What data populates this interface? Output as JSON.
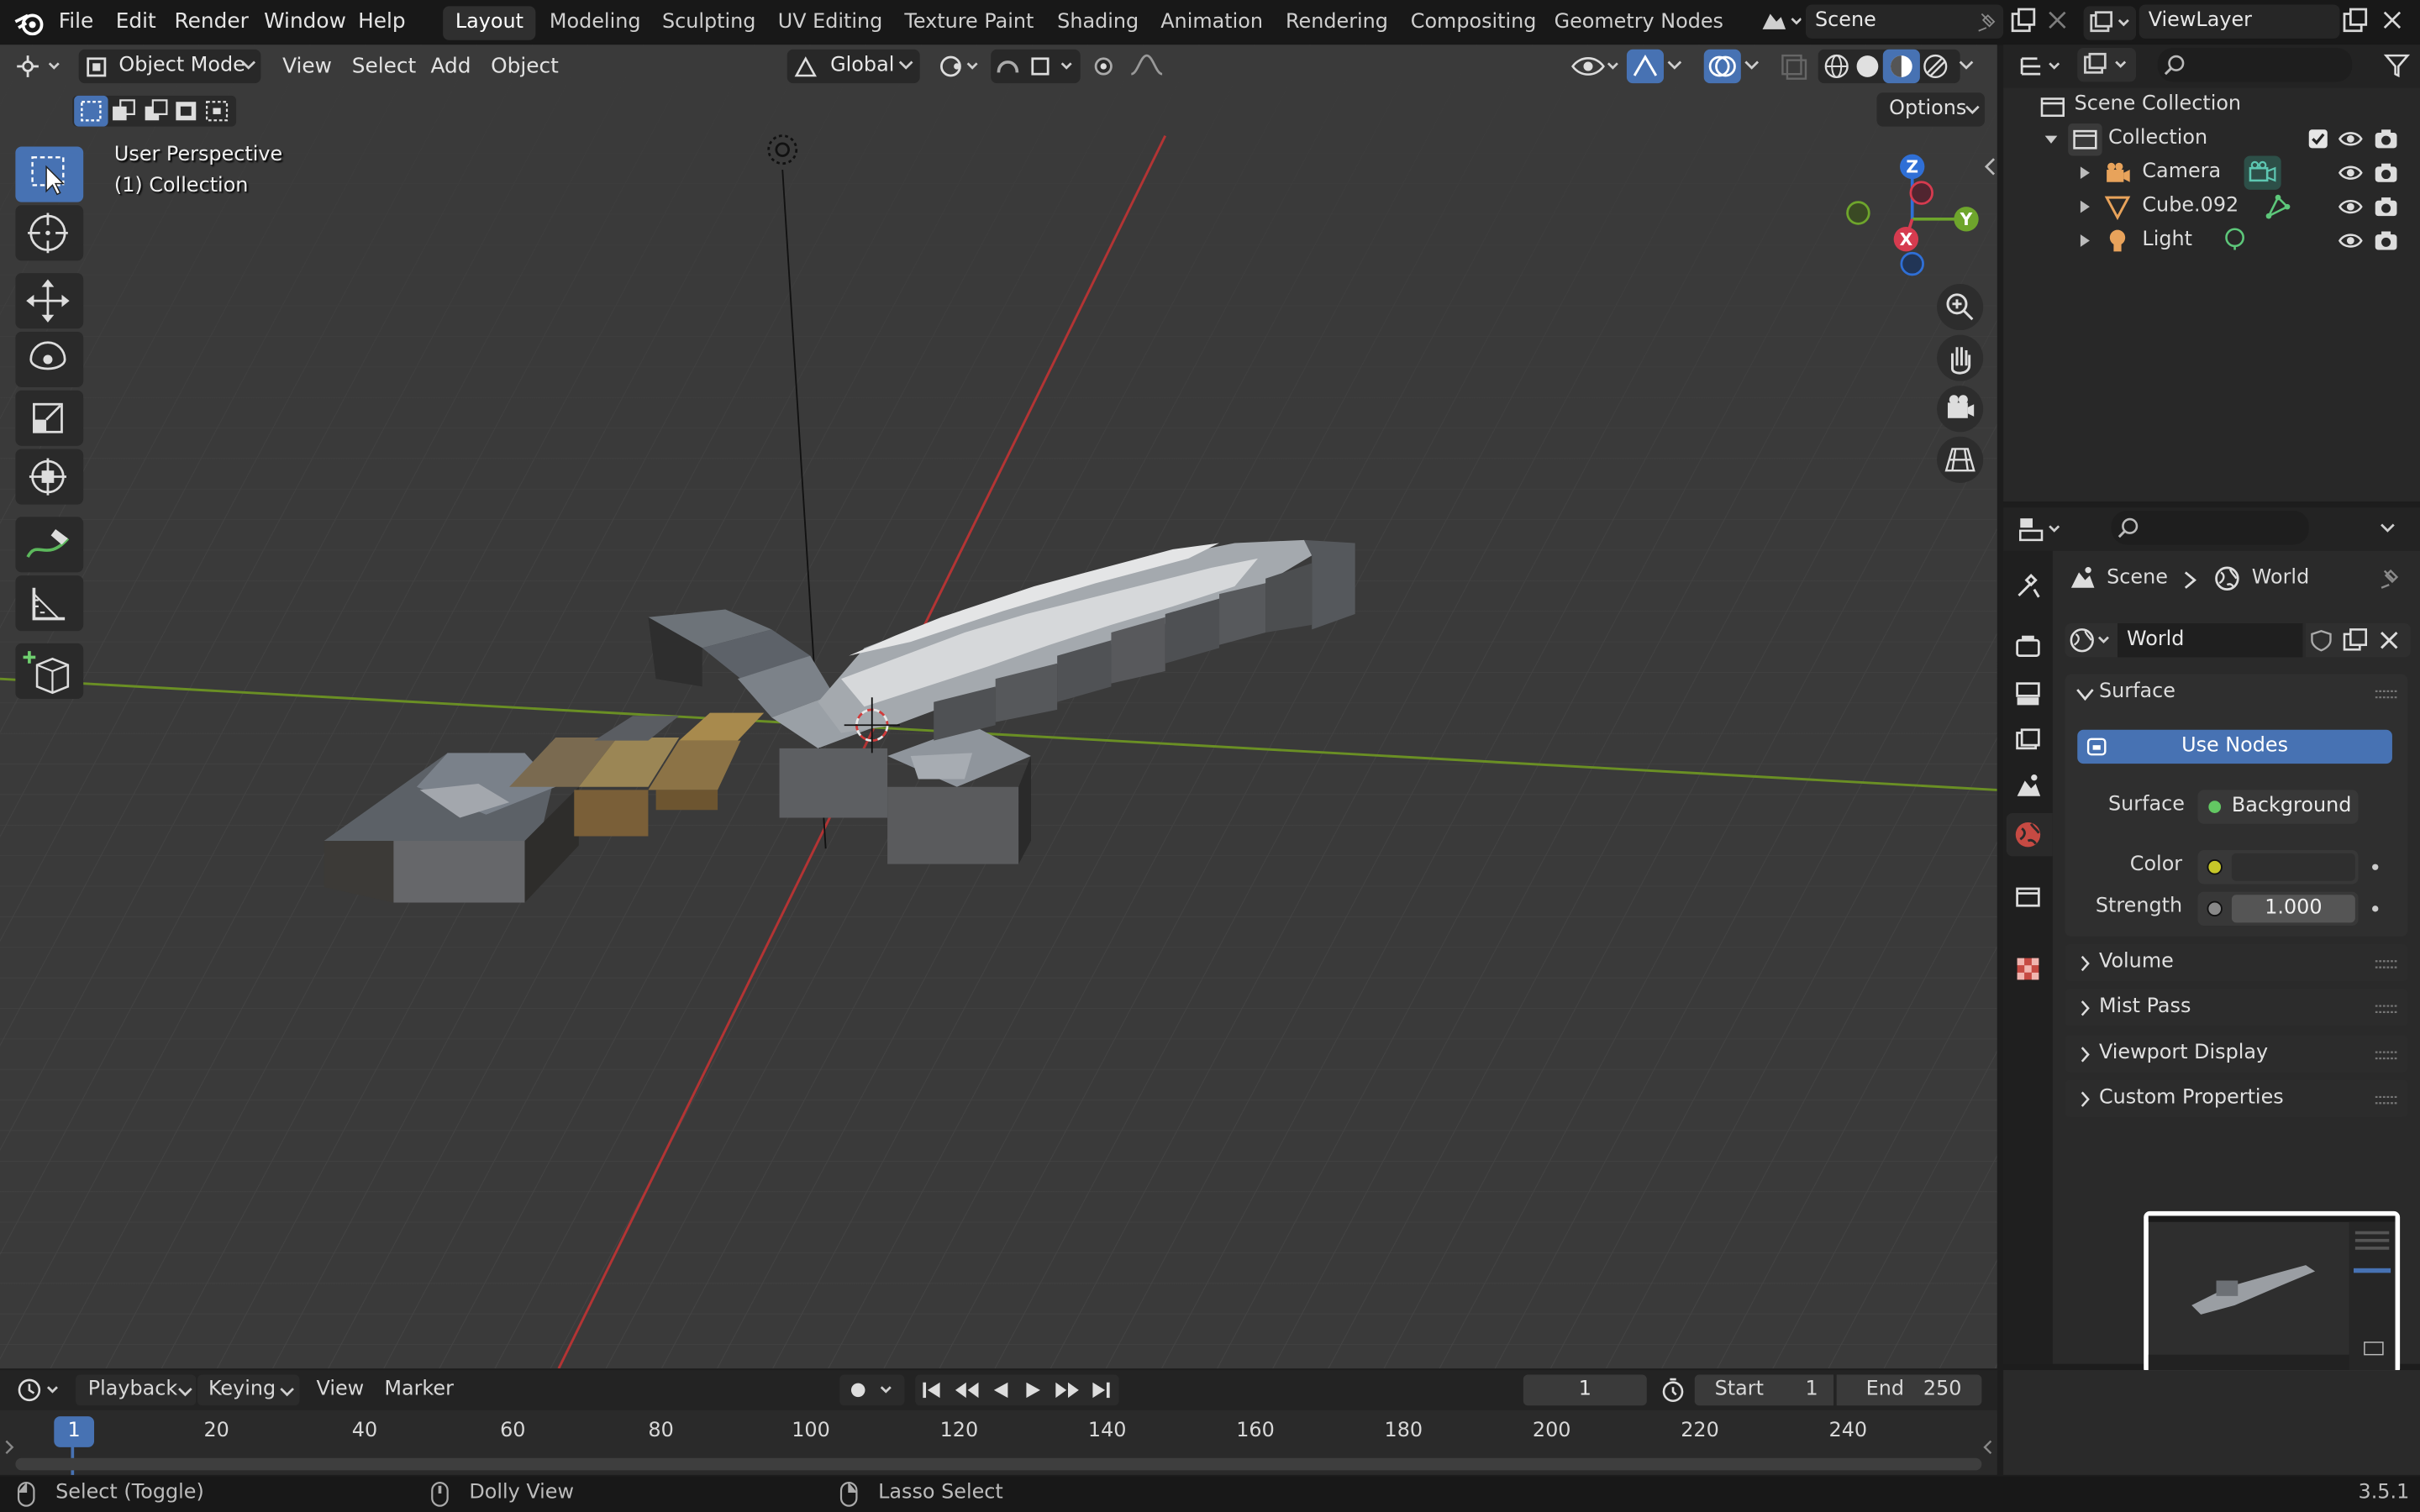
{
  "menu": {
    "file": "File",
    "edit": "Edit",
    "render": "Render",
    "window": "Window",
    "help": "Help"
  },
  "workspaces": [
    "Layout",
    "Modeling",
    "Sculpting",
    "UV Editing",
    "Texture Paint",
    "Shading",
    "Animation",
    "Rendering",
    "Compositing",
    "Geometry Nodes"
  ],
  "active_workspace": "Layout",
  "scene_field": "Scene",
  "viewlayer_field": "ViewLayer",
  "viewport": {
    "mode": "Object Mode",
    "menus": [
      "View",
      "Select",
      "Add",
      "Object"
    ],
    "orientation": "Global",
    "options": "Options",
    "overlay_title": "User Perspective",
    "overlay_collection": "(1) Collection",
    "gizmo": {
      "x": "X",
      "y": "Y",
      "z": "Z"
    }
  },
  "outliner": {
    "scene_collection": "Scene Collection",
    "collection": "Collection",
    "items": [
      {
        "name": "Camera",
        "icon": "camera-icon"
      },
      {
        "name": "Cube.092",
        "icon": "mesh-icon"
      },
      {
        "name": "Light",
        "icon": "light-icon"
      }
    ]
  },
  "properties": {
    "breadcrumb_scene": "Scene",
    "breadcrumb_world": "World",
    "world_name": "World",
    "surface_panel": "Surface",
    "use_nodes": "Use Nodes",
    "surface_label": "Surface",
    "surface_value": "Background",
    "color_label": "Color",
    "strength_label": "Strength",
    "strength_value": "1.000",
    "subpanels": [
      "Volume",
      "Mist Pass",
      "Viewport Display",
      "Custom Properties"
    ],
    "colors": {
      "use_nodes": "#4772b3",
      "background_socket": "#63c763",
      "color_socket": "#c7c729"
    }
  },
  "timeline": {
    "menus": [
      "Playback",
      "Keying",
      "View",
      "Marker"
    ],
    "current_frame": "1",
    "start_label": "Start",
    "start_value": "1",
    "end_label": "End",
    "end_value": "250",
    "ticks": [
      "20",
      "40",
      "60",
      "80",
      "100",
      "120",
      "140",
      "160",
      "180",
      "200",
      "220",
      "240"
    ],
    "playhead": "1"
  },
  "statusbar": {
    "select": "Select (Toggle)",
    "dolly": "Dolly View",
    "lasso": "Lasso Select",
    "version": "3.5.1"
  }
}
